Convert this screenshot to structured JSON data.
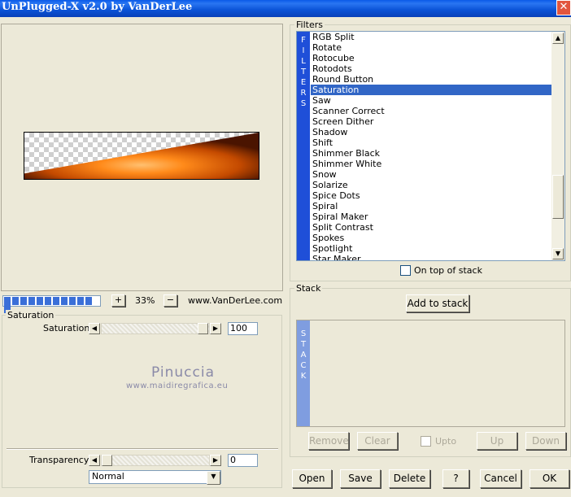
{
  "window": {
    "title": "UnPlugged-X v2.0 by VanDerLee",
    "close_glyph": "✕"
  },
  "preview": {
    "zoom_value": "33%",
    "zoom_plus": "+",
    "zoom_minus": "−",
    "website": "www.VanDerLee.com",
    "progress_fraction": 1.0
  },
  "filters": {
    "group_label": "Filters",
    "strip_text": [
      "F",
      "I",
      "L",
      "T",
      "E",
      "R",
      "S"
    ],
    "items": [
      "RGB Split",
      "Rotate",
      "Rotocube",
      "Rotodots",
      "Round Button",
      "Saturation",
      "Saw",
      "Scanner Correct",
      "Screen Dither",
      "Shadow",
      "Shift",
      "Shimmer Black",
      "Shimmer White",
      "Snow",
      "Solarize",
      "Spice Dots",
      "Spiral",
      "Spiral Maker",
      "Split Contrast",
      "Spokes",
      "Spotlight",
      "Star Maker"
    ],
    "selected": "Saturation",
    "on_top_label": "On top of stack"
  },
  "params": {
    "group_label": "Saturation",
    "saturation_label": "Saturation",
    "saturation_value": "100",
    "transparency_label": "Transparency",
    "transparency_value": "0",
    "blend_mode": "Normal"
  },
  "watermark": {
    "line1": "Pinuccia",
    "line2": "www.maidiregrafica.eu"
  },
  "stack": {
    "group_label": "Stack",
    "add_label": "Add to stack",
    "strip_text": [
      "S",
      "T",
      "A",
      "C",
      "K"
    ],
    "remove_label": "Remove",
    "clear_label": "Clear",
    "upto_label": "Upto",
    "up_label": "Up",
    "down_label": "Down"
  },
  "footer": {
    "open": "Open",
    "save": "Save",
    "delete": "Delete",
    "help": "?",
    "cancel": "Cancel",
    "ok": "OK"
  },
  "colors": {
    "titlebar": "#0a52d6",
    "selection": "#3166c6",
    "filter_strip": "#1f4fd8",
    "stack_strip": "#7f9de0",
    "preview_orange": "#ff8a1a"
  }
}
